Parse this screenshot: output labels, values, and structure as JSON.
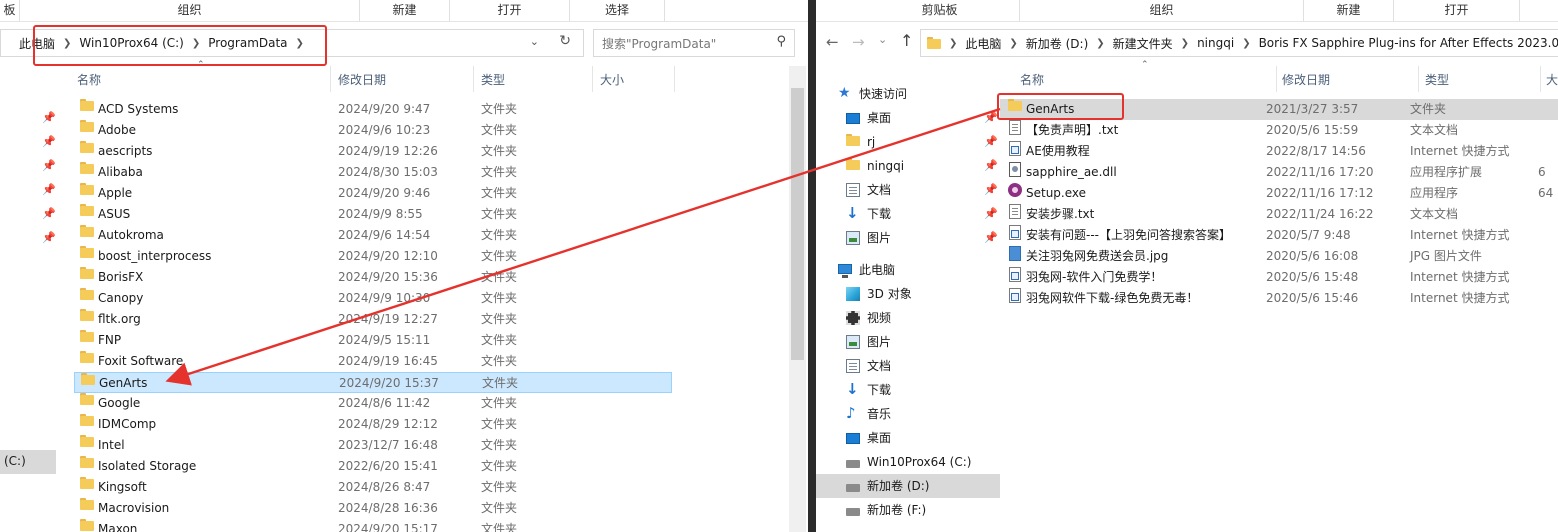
{
  "left": {
    "ribbon": {
      "g0": "板",
      "g1": "组织",
      "g2": "新建",
      "g3": "打开",
      "g4": "选择"
    },
    "breadcrumb": [
      "此电脑",
      "Win10Prox64 (C:)",
      "ProgramData"
    ],
    "search_placeholder": "搜索\"ProgramData\"",
    "columns": {
      "name": "名称",
      "date": "修改日期",
      "type": "类型",
      "size": "大小"
    },
    "nav_drive_label": "(C:)",
    "files": [
      {
        "name": "ACD Systems",
        "date": "2024/9/20 9:47",
        "type": "文件夹"
      },
      {
        "name": "Adobe",
        "date": "2024/9/6 10:23",
        "type": "文件夹"
      },
      {
        "name": "aescripts",
        "date": "2024/9/19 12:26",
        "type": "文件夹"
      },
      {
        "name": "Alibaba",
        "date": "2024/8/30 15:03",
        "type": "文件夹"
      },
      {
        "name": "Apple",
        "date": "2024/9/20 9:46",
        "type": "文件夹"
      },
      {
        "name": "ASUS",
        "date": "2024/9/9 8:55",
        "type": "文件夹"
      },
      {
        "name": "Autokroma",
        "date": "2024/9/6 14:54",
        "type": "文件夹"
      },
      {
        "name": "boost_interprocess",
        "date": "2024/9/20 12:10",
        "type": "文件夹"
      },
      {
        "name": "BorisFX",
        "date": "2024/9/20 15:36",
        "type": "文件夹"
      },
      {
        "name": "Canopy",
        "date": "2024/9/9 10:30",
        "type": "文件夹"
      },
      {
        "name": "fltk.org",
        "date": "2024/9/19 12:27",
        "type": "文件夹"
      },
      {
        "name": "FNP",
        "date": "2024/9/5 15:11",
        "type": "文件夹"
      },
      {
        "name": "Foxit Software",
        "date": "2024/9/19 16:45",
        "type": "文件夹"
      },
      {
        "name": "GenArts",
        "date": "2024/9/20 15:37",
        "type": "文件夹"
      },
      {
        "name": "Google",
        "date": "2024/8/6 11:42",
        "type": "文件夹"
      },
      {
        "name": "IDMComp",
        "date": "2024/8/29 12:12",
        "type": "文件夹"
      },
      {
        "name": "Intel",
        "date": "2023/12/7 16:48",
        "type": "文件夹"
      },
      {
        "name": "Isolated Storage",
        "date": "2022/6/20 15:41",
        "type": "文件夹"
      },
      {
        "name": "Kingsoft",
        "date": "2024/8/26 8:47",
        "type": "文件夹"
      },
      {
        "name": "Macrovision",
        "date": "2024/8/28 16:36",
        "type": "文件夹"
      },
      {
        "name": "Maxon",
        "date": "2024/9/20 15:17",
        "type": "文件夹"
      }
    ]
  },
  "right": {
    "ribbon": {
      "g0": "剪贴板",
      "g1": "组织",
      "g2": "新建",
      "g3": "打开"
    },
    "breadcrumb": [
      "此电脑",
      "新加卷 (D:)",
      "新建文件夹",
      "ningqi",
      "Boris FX Sapphire Plug-ins for After Effects 2023.0"
    ],
    "columns": {
      "name": "名称",
      "date": "修改日期",
      "type": "类型",
      "size": "大"
    },
    "nav": [
      {
        "label": "快速访问",
        "icon": "star-icon"
      },
      {
        "label": "桌面",
        "icon": "desktop-icon"
      },
      {
        "label": "rj",
        "icon": "folder-icon"
      },
      {
        "label": "ningqi",
        "icon": "folder-icon"
      },
      {
        "label": "文档",
        "icon": "document-icon"
      },
      {
        "label": "下载",
        "icon": "download-icon"
      },
      {
        "label": "图片",
        "icon": "picture-icon"
      },
      {
        "label": "此电脑",
        "icon": "computer-icon"
      },
      {
        "label": "3D 对象",
        "icon": "cube-icon"
      },
      {
        "label": "视频",
        "icon": "video-icon"
      },
      {
        "label": "图片",
        "icon": "picture-icon"
      },
      {
        "label": "文档",
        "icon": "document-icon"
      },
      {
        "label": "下载",
        "icon": "download-icon"
      },
      {
        "label": "音乐",
        "icon": "music-icon"
      },
      {
        "label": "桌面",
        "icon": "desktop-icon"
      },
      {
        "label": "Win10Prox64 (C:)",
        "icon": "windows-drive-icon"
      },
      {
        "label": "新加卷 (D:)",
        "icon": "drive-icon"
      },
      {
        "label": "新加卷 (F:)",
        "icon": "drive-icon"
      }
    ],
    "files": [
      {
        "name": "GenArts",
        "date": "2021/3/27 3:57",
        "type": "文件夹",
        "size": "",
        "icon": "folder"
      },
      {
        "name": "【免责声明】.txt",
        "date": "2020/5/6 15:59",
        "type": "文本文档",
        "size": "",
        "icon": "txt"
      },
      {
        "name": "AE使用教程",
        "date": "2022/8/17 14:56",
        "type": "Internet 快捷方式",
        "size": "",
        "icon": "link"
      },
      {
        "name": "sapphire_ae.dll",
        "date": "2022/11/16 17:20",
        "type": "应用程序扩展",
        "size": "6",
        "icon": "dll"
      },
      {
        "name": "Setup.exe",
        "date": "2022/11/16 17:12",
        "type": "应用程序",
        "size": "64",
        "icon": "exe"
      },
      {
        "name": "安装步骤.txt",
        "date": "2022/11/24 16:22",
        "type": "文本文档",
        "size": "",
        "icon": "txt"
      },
      {
        "name": "安装有问题---【上羽免问答搜索答案】",
        "date": "2020/5/7 9:48",
        "type": "Internet 快捷方式",
        "size": "",
        "icon": "link"
      },
      {
        "name": "关注羽兔网免费送会员.jpg",
        "date": "2020/5/6 16:08",
        "type": "JPG 图片文件",
        "size": "",
        "icon": "jpg"
      },
      {
        "name": "羽兔网-软件入门免费学！",
        "date": "2020/5/6 15:48",
        "type": "Internet 快捷方式",
        "size": "",
        "icon": "link"
      },
      {
        "name": "羽兔网软件下载-绿色免费无毒！",
        "date": "2020/5/6 15:46",
        "type": "Internet 快捷方式",
        "size": "",
        "icon": "link"
      }
    ]
  },
  "colors": {
    "highlight": "#e5322d",
    "selection": "#cce8ff",
    "folder": "#f5cc5a"
  }
}
